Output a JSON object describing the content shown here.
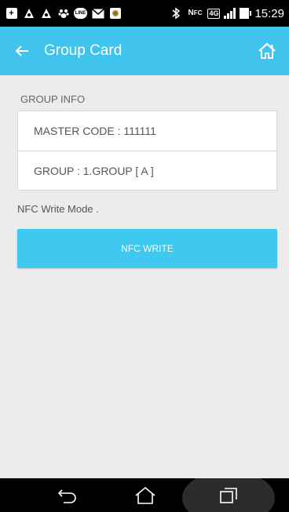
{
  "status_bar": {
    "time": "15:29",
    "network_label": "4G"
  },
  "app_bar": {
    "title": "Group Card",
    "back_icon": "arrow-left-icon",
    "home_icon": "home-icon",
    "background": "#40c4ee"
  },
  "group_info": {
    "section_label": "GROUP INFO",
    "master_code": "MASTER CODE : 111111",
    "group": "GROUP : 1.GROUP [ A ]"
  },
  "mode_text": "NFC  Write Mode .",
  "nfc_write_button": {
    "label": "NFC WRITE",
    "color": "#3fc8f0"
  },
  "nav_bar": {
    "icons": [
      "back-icon",
      "home-icon",
      "recent-apps-icon"
    ]
  }
}
